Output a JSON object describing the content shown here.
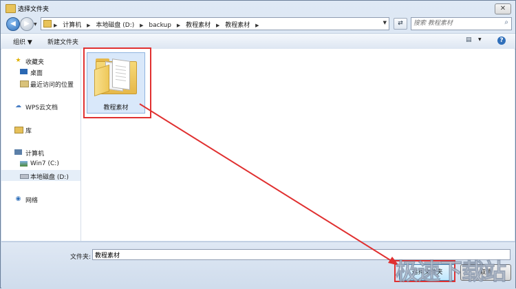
{
  "window": {
    "title": "选择文件夹",
    "close_icon": "x"
  },
  "nav": {
    "back_icon": "arrow-left",
    "forward_icon": "arrow-right",
    "breadcrumbs": [
      "计算机",
      "本地磁盘 (D:)",
      "backup",
      "教程素材",
      "教程素材"
    ],
    "separator": "▶",
    "refresh_icon": "refresh",
    "search_placeholder": "搜索 教程素材"
  },
  "toolbar": {
    "organize_label": "组织 ▼",
    "new_folder_label": "新建文件夹",
    "view_icon": "view-menu",
    "help_icon": "?"
  },
  "sidebar": {
    "items": [
      {
        "label": "收藏夹",
        "icon": "star",
        "indent": false
      },
      {
        "label": "桌面",
        "icon": "desktop",
        "indent": true
      },
      {
        "label": "最近访问的位置",
        "icon": "recent",
        "indent": true
      },
      {
        "label": "WPS云文档",
        "icon": "cloud",
        "indent": false
      },
      {
        "label": "库",
        "icon": "library",
        "indent": false
      },
      {
        "label": "计算机",
        "icon": "computer",
        "indent": false
      },
      {
        "label": "Win7 (C:)",
        "icon": "drive-c",
        "indent": true
      },
      {
        "label": "本地磁盘 (D:)",
        "icon": "drive-d",
        "indent": true,
        "selected": true
      },
      {
        "label": "网络",
        "icon": "network",
        "indent": false
      }
    ]
  },
  "content": {
    "items": [
      {
        "name": "教程素材",
        "type": "folder",
        "selected": true
      }
    ]
  },
  "bottom": {
    "folder_label": "文件夹:",
    "folder_value": "教程素材",
    "select_button": "选择文件夹",
    "cancel_button": "取消"
  },
  "watermark": "极速下载站",
  "colors": {
    "highlight": "#e03030",
    "selection": "#d9e8fa",
    "accent": "#2f6fba"
  }
}
